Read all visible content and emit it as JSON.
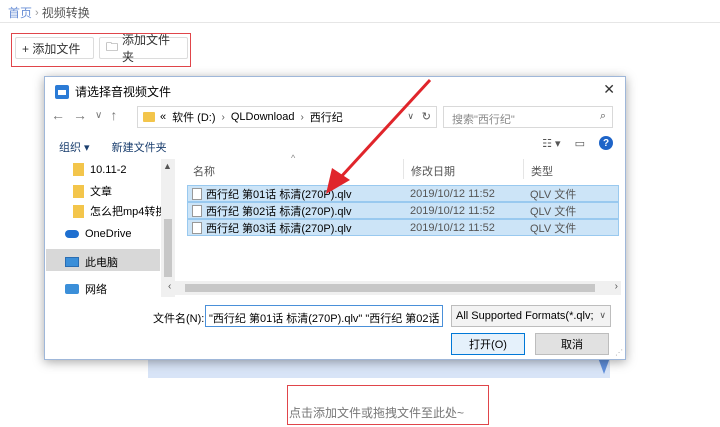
{
  "breadcrumb": {
    "home": "首页",
    "sep": "›",
    "current": "视频转换"
  },
  "toolbar": {
    "add_file": "+ 添加文件",
    "add_folder": "添加文件夹"
  },
  "dropzone": {
    "text": "点击添加文件或拖拽文件至此处~"
  },
  "dialog": {
    "title": "请选择音视频文件",
    "close": "✕",
    "nav": {
      "back": "←",
      "forward": "→",
      "recent": "∨",
      "up": "↑"
    },
    "address": {
      "prefix": "«",
      "path": [
        "软件 (D:)",
        "QLDownload",
        "西行纪"
      ],
      "sep": "›"
    },
    "search_placeholder": "搜索\"西行纪\"",
    "commands": {
      "organize": "组织 ▾",
      "new_folder": "新建文件夹"
    },
    "help": "?",
    "nav_items": [
      "10.11-2",
      "文章",
      "怎么把mp4转换",
      "OneDrive",
      "此电脑",
      "网络"
    ],
    "columns": {
      "name": "名称",
      "date": "修改日期",
      "type": "类型"
    },
    "files": [
      {
        "name": "西行纪 第01话 标清(270P).qlv",
        "date": "2019/10/12 11:52",
        "type": "QLV 文件"
      },
      {
        "name": "西行纪 第02话 标清(270P).qlv",
        "date": "2019/10/12 11:52",
        "type": "QLV 文件"
      },
      {
        "name": "西行纪 第03话 标清(270P).qlv",
        "date": "2019/10/12 11:52",
        "type": "QLV 文件"
      }
    ],
    "filename_label": "文件名(N):",
    "filename_value": "\"西行纪 第01话 标清(270P).qlv\" \"西行纪 第02话",
    "filter_value": "All Supported Formats(*.qlv;",
    "open_button": "打开(O)",
    "cancel_button": "取消"
  },
  "colors": {
    "accent_red": "#e0454a",
    "selection": "#cce4f7",
    "link_blue": "#6a8fd6"
  }
}
